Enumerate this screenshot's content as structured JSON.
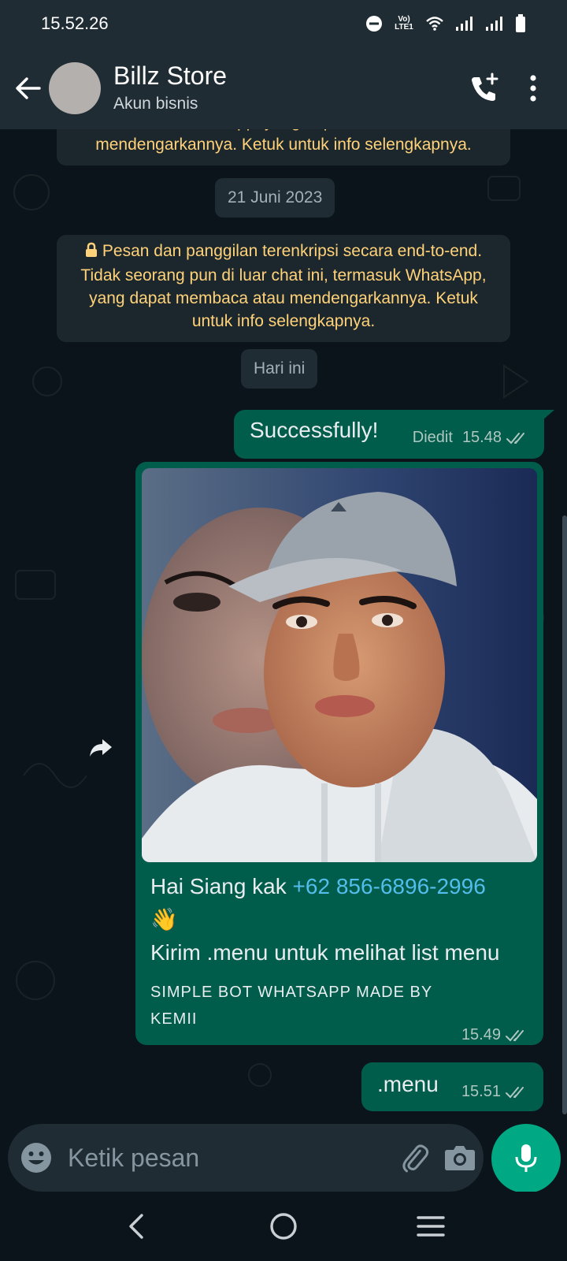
{
  "status_bar": {
    "time": "15.52.26",
    "lte_label": "Vo) LTE1"
  },
  "header": {
    "contact_name": "Billz Store",
    "subtitle": "Akun bisnis"
  },
  "chat": {
    "encryption_notice_partial": "termasuk WhatsApp, yang dapat membaca atau mendengarkannya. Ketuk untuk info selengkapnya.",
    "date_label_1": "21 Juni 2023",
    "encryption_notice": "Pesan dan panggilan terenkripsi secara end-to-end. Tidak seorang pun di luar chat ini, termasuk WhatsApp, yang dapat membaca atau mendengarkannya. Ketuk untuk info selengkapnya.",
    "date_label_2": "Hari ini",
    "messages": [
      {
        "text": "Successfully!",
        "edited_label": "Diedit",
        "time": "15.48"
      },
      {
        "caption_prefix": "Hai Siang kak ",
        "phone": "+62 856-6896-2996",
        "wave_emoji": "👋",
        "caption_line2": "Kirim .menu untuk melihat list menu",
        "footer": "SIMPLE BOT WHATSAPP MADE BY KEMII",
        "time": "15.49"
      },
      {
        "text": ".menu",
        "time": "15.51"
      }
    ]
  },
  "input": {
    "placeholder": "Ketik pesan"
  },
  "icons": {
    "back": "arrow-left-icon",
    "call": "add-call-icon",
    "menu": "more-vert-icon",
    "forward": "forward-icon",
    "emoji": "emoji-icon",
    "attach": "paperclip-icon",
    "camera": "camera-icon",
    "mic": "mic-icon",
    "read": "double-check-icon"
  },
  "colors": {
    "header_bg": "#1f2c34",
    "chat_bg": "#0b141a",
    "outgoing_bubble": "#005c4b",
    "system_text": "#ffd279",
    "link": "#53bdeb",
    "accent": "#00a884"
  }
}
